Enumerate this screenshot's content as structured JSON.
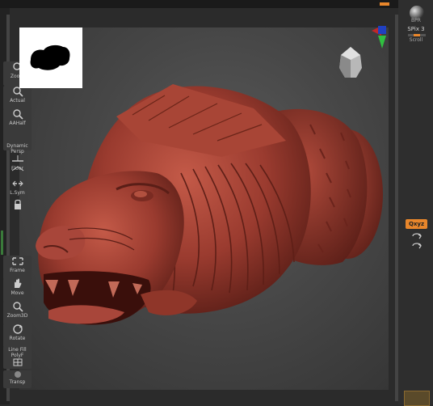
{
  "shelf": {
    "bpr": "BPR",
    "spix_label": "SPix 3",
    "spix_value": 0.5,
    "scroll": "Scroll",
    "zoom": "Zoom",
    "actual": "Actual",
    "aahalf": "AAHalf",
    "dynamic_persp": "Dynamic\nPersp",
    "floor": "Floor",
    "lsym": "L.Sym",
    "lock_label": "",
    "xyz": "Qxyz",
    "frame": "Frame",
    "move": "Move",
    "zoom3d": "Zoom3D",
    "rotate": "Rotate",
    "line_fill": "Line Fill\nPolyF",
    "transp": "Transp"
  },
  "colors": {
    "accent": "#e8862b",
    "model": "#9a3b2f",
    "background": "#2b2b2b"
  },
  "icons": [
    "bpr-sphere-icon",
    "scroll-icon",
    "zoom-icon",
    "actual-icon",
    "aahalf-icon",
    "persp-icon",
    "floor-icon",
    "symmetry-icon",
    "lock-icon",
    "rotate-y-icon",
    "rotate-z-icon",
    "frame-icon",
    "move-icon",
    "zoom3d-icon",
    "rotate-icon",
    "polyf-icon",
    "transp-icon"
  ]
}
